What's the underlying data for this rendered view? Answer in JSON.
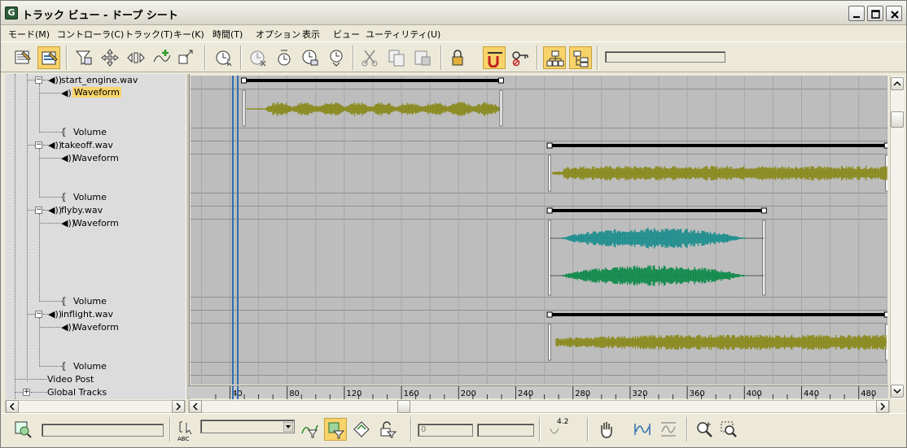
{
  "window": {
    "title": "トラック ビュー - ドープ シート"
  },
  "menu": [
    "モード(M)",
    "コントローラ(C)",
    "トラック(T)",
    "キー(K)",
    "時間(T)",
    "オプション",
    "表示",
    "ビュー",
    "ユーティリティ(U)"
  ],
  "tree": {
    "items": [
      {
        "label": "start_engine.wav",
        "kind": "sound"
      },
      {
        "label": "Waveform",
        "kind": "waveform",
        "selected": true
      },
      {
        "label": "Volume",
        "kind": "volume"
      },
      {
        "label": "takeoff.wav",
        "kind": "sound"
      },
      {
        "label": "Waveform",
        "kind": "waveform"
      },
      {
        "label": "Volume",
        "kind": "volume"
      },
      {
        "label": "flyby.wav",
        "kind": "sound"
      },
      {
        "label": "Waveform",
        "kind": "waveform"
      },
      {
        "label": "Volume",
        "kind": "volume"
      },
      {
        "label": "inflight.wav",
        "kind": "sound"
      },
      {
        "label": "Waveform",
        "kind": "waveform"
      },
      {
        "label": "Volume",
        "kind": "volume"
      },
      {
        "label": "Video Post",
        "kind": "root"
      },
      {
        "label": "Global Tracks",
        "kind": "root"
      }
    ]
  },
  "ruler": {
    "labels": [
      "40",
      "80",
      "120",
      "160",
      "200",
      "240",
      "280",
      "320",
      "360",
      "400",
      "440",
      "480"
    ],
    "current_frame": 44
  },
  "tracks": [
    {
      "name": "start_engine.wav",
      "range": [
        50,
        230
      ],
      "color": "#8a8a1e"
    },
    {
      "name": "takeoff.wav",
      "range": [
        264,
        500
      ],
      "color": "#8a8a1e"
    },
    {
      "name": "flyby.wav",
      "range": [
        264,
        414
      ],
      "colors": [
        "#1e8e8e",
        "#0f8a4a"
      ]
    },
    {
      "name": "inflight.wav",
      "range": [
        264,
        500
      ],
      "color": "#8a8a1e"
    }
  ],
  "bottom": {
    "field_a": "",
    "field_b": "0",
    "field_c": "",
    "label_abc": "ABC",
    "curve_label": "4.2"
  },
  "colors": {
    "selection": "#f8d36a",
    "sheet_bg": "#bdbdbd",
    "time_slider": "#2f6fb0"
  }
}
